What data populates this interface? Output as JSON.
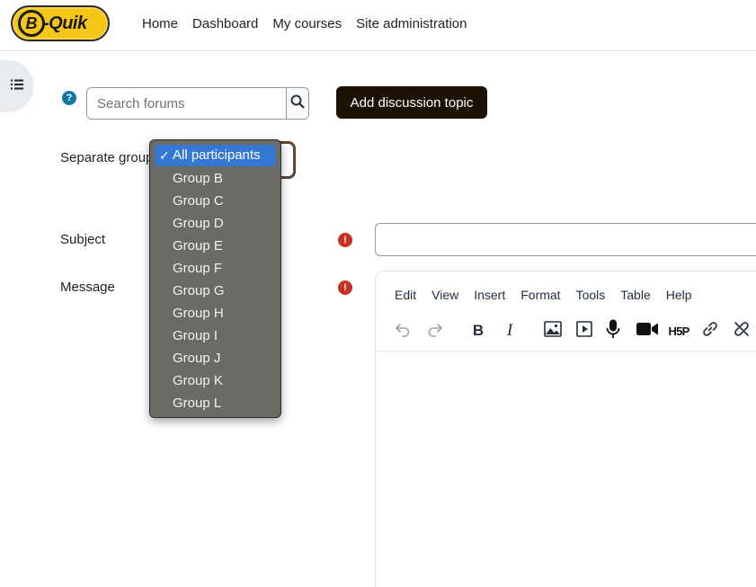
{
  "logo": {
    "letter": "B",
    "text": "-Quik"
  },
  "nav": {
    "items": [
      "Home",
      "Dashboard",
      "My courses",
      "Site administration"
    ]
  },
  "search": {
    "placeholder": "Search forums",
    "value": ""
  },
  "add_button": {
    "label": "Add discussion topic"
  },
  "form": {
    "group_label": "Separate group",
    "subject_label": "Subject",
    "message_label": "Message",
    "subject_value": ""
  },
  "group_options": {
    "selected": "All participants",
    "items": [
      "All participants",
      "Group B",
      "Group C",
      "Group D",
      "Group E",
      "Group F",
      "Group G",
      "Group H",
      "Group I",
      "Group J",
      "Group K",
      "Group L"
    ]
  },
  "editor": {
    "menus": [
      "Edit",
      "View",
      "Insert",
      "Format",
      "Tools",
      "Table",
      "Help"
    ],
    "tools": [
      "undo-icon",
      "redo-icon",
      "bold-icon",
      "italic-icon",
      "image-icon",
      "media-icon",
      "microphone-icon",
      "video-camera-icon",
      "h5p-icon",
      "link-icon",
      "unlink-icon"
    ],
    "h5p_label": "H5P"
  },
  "colors": {
    "accent_button": "#1b1204",
    "required": "#ca3120",
    "help": "#1177a6",
    "dropdown_bg": "#6b6b66",
    "dropdown_selected": "#3478d4",
    "logo": "#f5c518"
  }
}
